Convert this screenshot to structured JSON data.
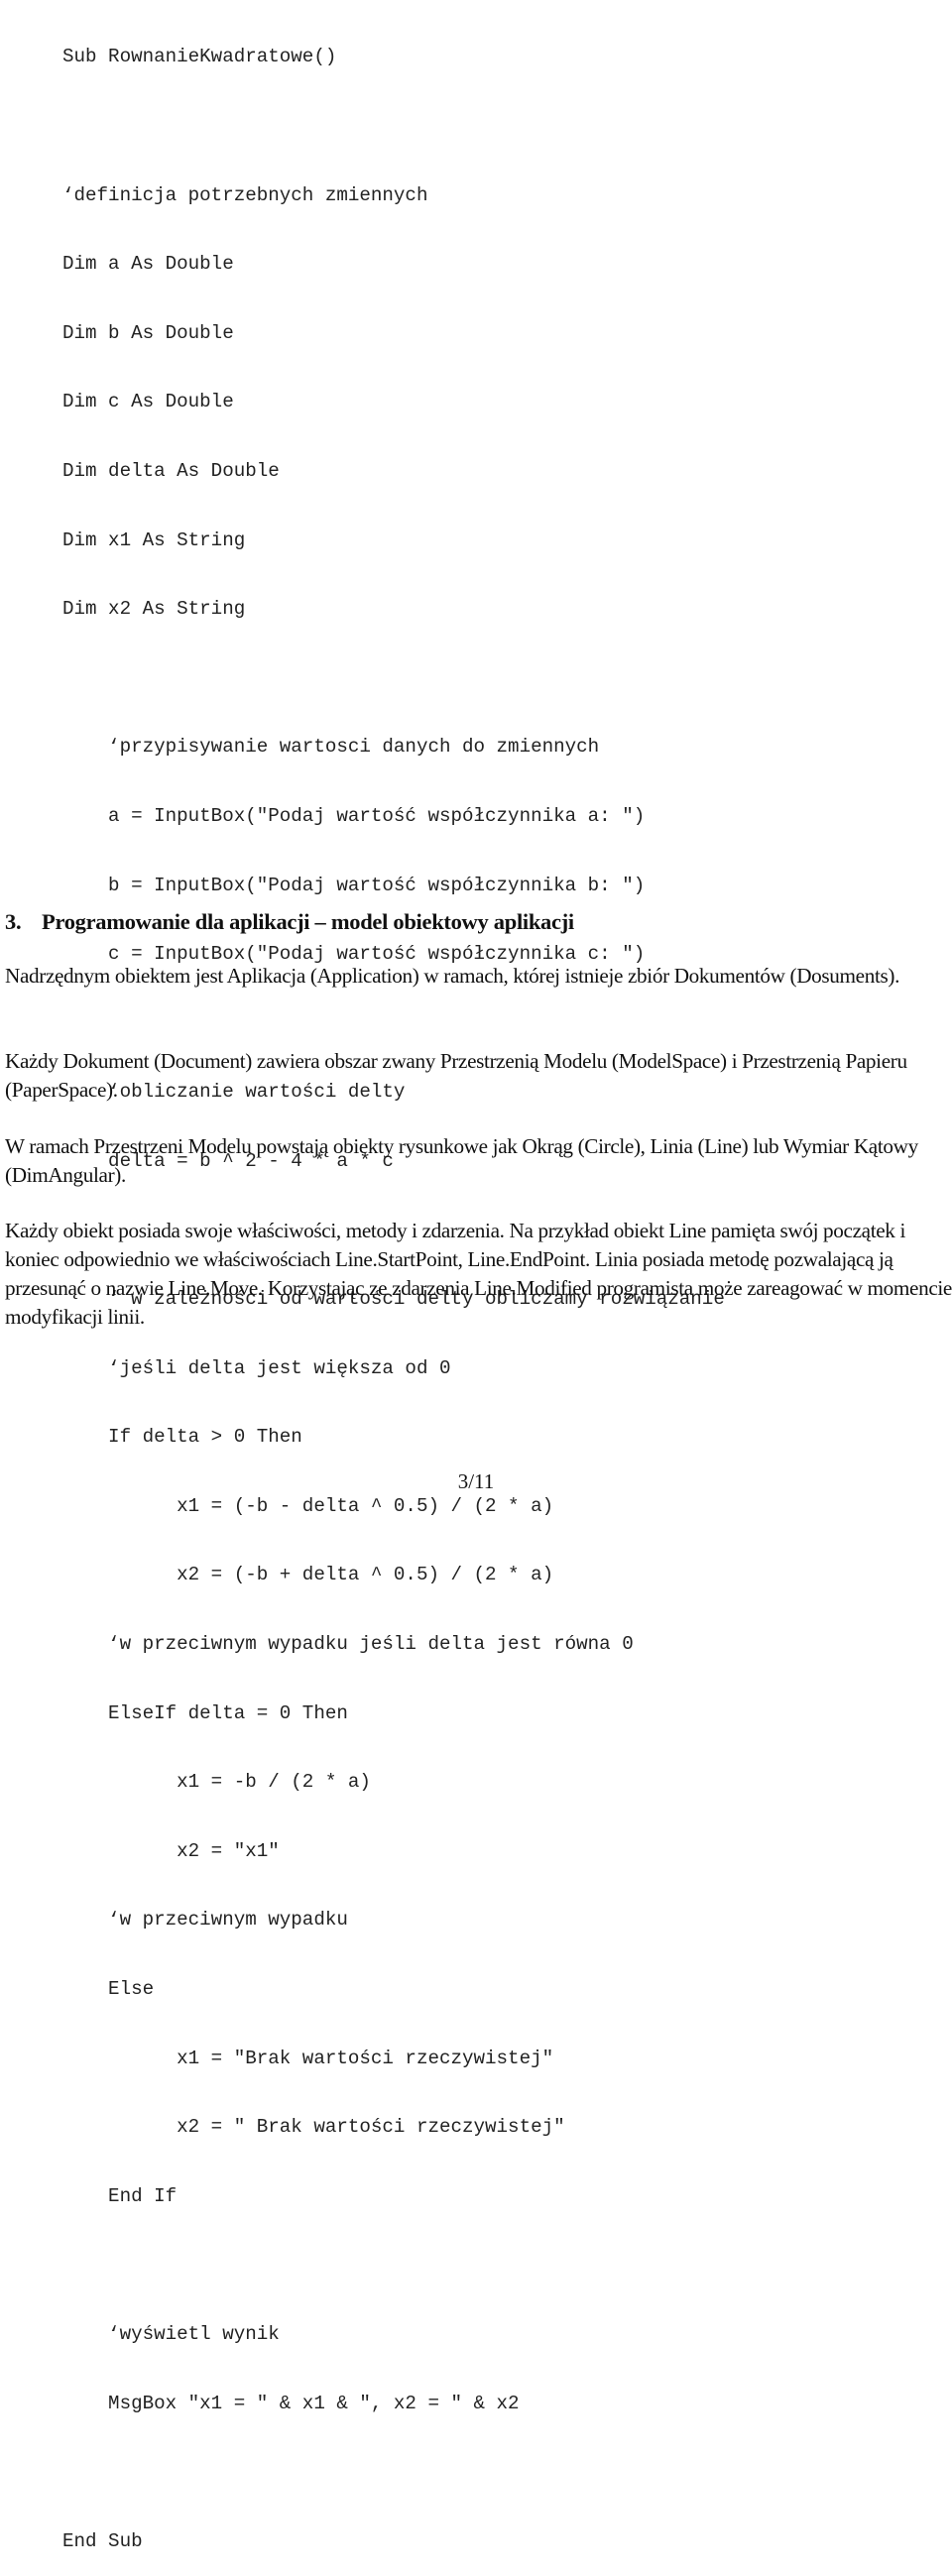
{
  "code": {
    "lines": [
      "Sub RownanieKwadratowe()",
      "",
      "‘definicja potrzebnych zmiennych",
      "Dim a As Double",
      "Dim b As Double",
      "Dim c As Double",
      "Dim delta As Double",
      "Dim x1 As String",
      "Dim x2 As String",
      "",
      "    ‘przypisywanie wartosci danych do zmiennych",
      "    a = InputBox(\"Podaj wartość współczynnika a: \")",
      "    b = InputBox(\"Podaj wartość współczynnika b: \")",
      "    c = InputBox(\"Podaj wartość współczynnika c: \")",
      "",
      "    ‘obliczanie wartości delty",
      "    delta = b ^ 2 - 4 * a * c",
      "",
      "    ‘ w zależności od wartości delty obliczamy rozwiązanie",
      "    ‘jeśli delta jest większa od 0",
      "    If delta > 0 Then",
      "          x1 = (-b - delta ^ 0.5) / (2 * a)",
      "          x2 = (-b + delta ^ 0.5) / (2 * a)",
      "    ‘w przeciwnym wypadku jeśli delta jest równa 0",
      "    ElseIf delta = 0 Then",
      "          x1 = -b / (2 * a)",
      "          x2 = \"x1\"",
      "    ‘w przeciwnym wypadku",
      "    Else",
      "          x1 = \"Brak wartości rzeczywistej\"",
      "          x2 = \" Brak wartości rzeczywistej\"",
      "    End If",
      "",
      "    ‘wyświetl wynik",
      "    MsgBox \"x1 = \" & x1 & \", x2 = \" & x2",
      "",
      "End Sub"
    ]
  },
  "section": {
    "number": "3.",
    "title": "Programowanie dla aplikacji – model obiektowy aplikacji"
  },
  "paragraphs": [
    "Nadrzędnym obiektem jest Aplikacja (Application) w ramach, której istnieje zbiór Dokumentów (Dosuments).",
    "Każdy Dokument (Document) zawiera obszar zwany Przestrzenią Modelu (ModelSpace) i Przestrzenią Papieru (PaperSpace).",
    "W ramach Przestrzeni Modelu powstają obiekty rysunkowe jak Okrąg (Circle), Linia (Line) lub Wymiar Kątowy (DimAngular).",
    "Każdy obiekt posiada swoje właściwości, metody i zdarzenia. Na przykład obiekt Line pamięta swój początek i koniec odpowiednio we właściwościach Line.StartPoint, Line.EndPoint. Linia posiada metodę pozwalającą ją przesunąć o nazwie Line.Move. Korzystając ze zdarzenia Line.Modified programista może zareagować w momencie modyfikacji linii."
  ],
  "footer": {
    "page_number": "3/11"
  }
}
